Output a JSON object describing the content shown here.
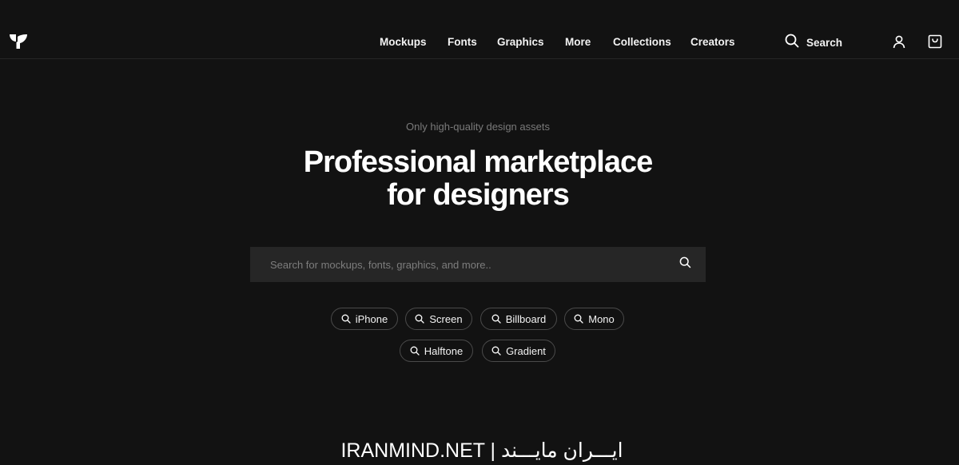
{
  "header": {
    "logo_icon": "leaf-logo-icon",
    "nav": [
      {
        "label": "Mockups"
      },
      {
        "label": "Fonts"
      },
      {
        "label": "Graphics"
      },
      {
        "label": "More"
      },
      {
        "label": "Collections"
      },
      {
        "label": "Creators"
      }
    ],
    "search_label": "Search",
    "search_icon": "search-icon",
    "account_icon": "user-icon",
    "cart_icon": "cart-icon"
  },
  "hero": {
    "tagline": "Only high-quality design assets",
    "title_line1": "Professional marketplace",
    "title_line2": "for designers"
  },
  "search": {
    "placeholder": "Search for mockups, fonts, graphics, and more..",
    "value": ""
  },
  "tags": [
    {
      "label": "iPhone"
    },
    {
      "label": "Screen"
    },
    {
      "label": "Billboard"
    },
    {
      "label": "Mono"
    },
    {
      "label": "Halftone"
    },
    {
      "label": "Gradient"
    }
  ],
  "watermark": {
    "text": "IRANMIND.NET | ایـــران مایـــند"
  },
  "colors": {
    "background": "#121212",
    "search_background": "#262626",
    "tag_border": "#4a4a4a",
    "muted_text": "#7a7a7a",
    "text": "#ffffff"
  }
}
